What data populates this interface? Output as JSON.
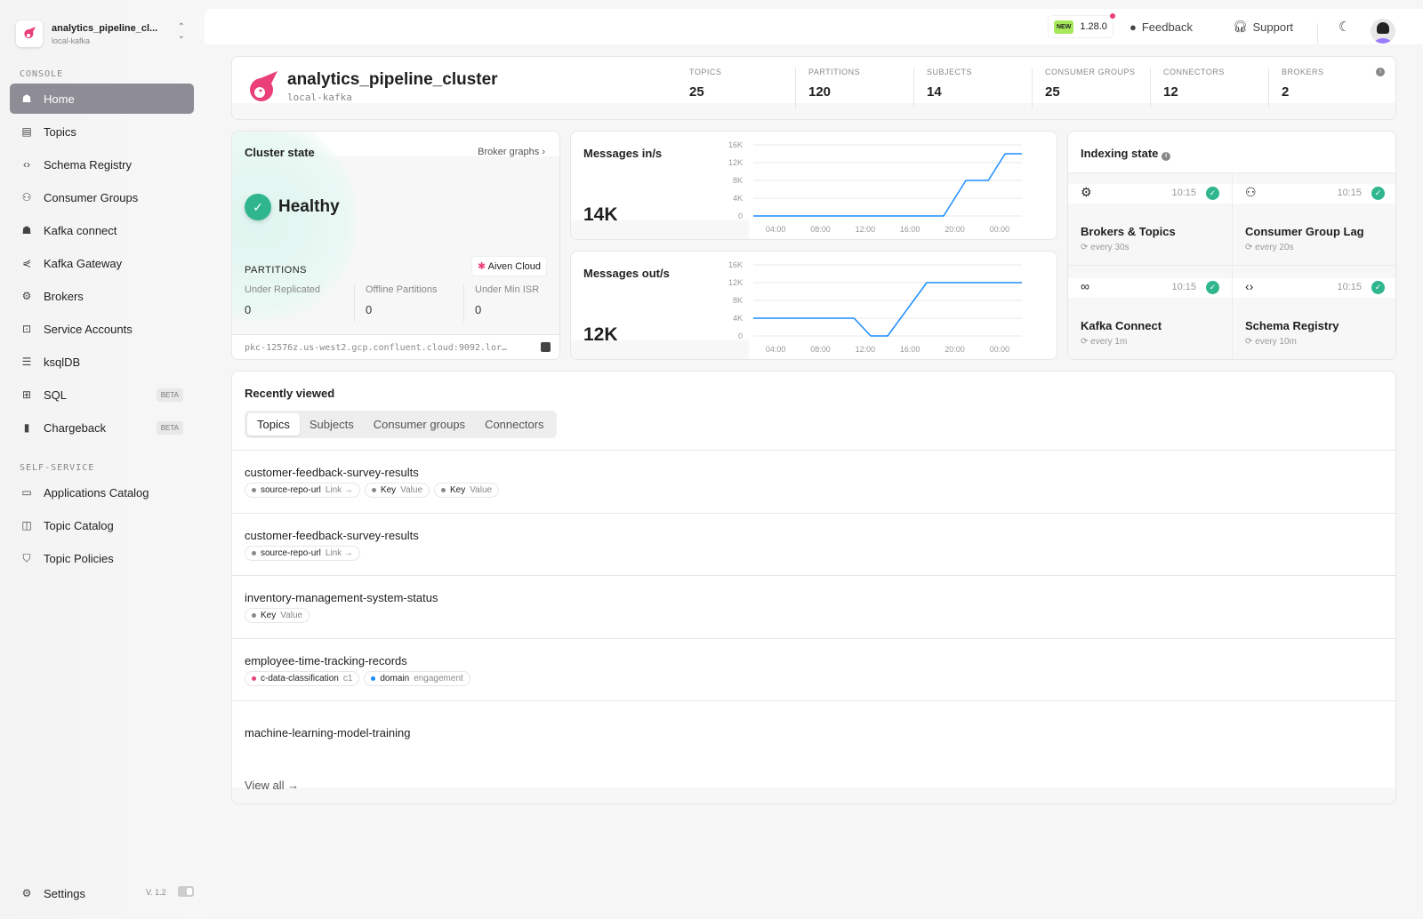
{
  "sidebar": {
    "cluster_name": "analytics_pipeline_cl...",
    "cluster_env": "local-kafka",
    "console_label": "CONSOLE",
    "self_service_label": "SELF-SERVICE",
    "items": [
      {
        "label": "Home",
        "icon": "home-icon"
      },
      {
        "label": "Topics",
        "icon": "topics-icon"
      },
      {
        "label": "Schema Registry",
        "icon": "code-icon"
      },
      {
        "label": "Consumer Groups",
        "icon": "hierarchy-icon"
      },
      {
        "label": "Kafka connect",
        "icon": "connect-icon"
      },
      {
        "label": "Kafka Gateway",
        "icon": "gateway-icon"
      },
      {
        "label": "Brokers",
        "icon": "chip-icon"
      },
      {
        "label": "Service Accounts",
        "icon": "account-lock-icon"
      },
      {
        "label": "ksqlDB",
        "icon": "database-icon"
      },
      {
        "label": "SQL",
        "icon": "table-icon",
        "badge": "BETA"
      },
      {
        "label": "Chargeback",
        "icon": "bar-chart-icon",
        "badge": "BETA"
      }
    ],
    "self_service": [
      {
        "label": "Applications Catalog",
        "icon": "window-icon"
      },
      {
        "label": "Topic Catalog",
        "icon": "catalog-icon"
      },
      {
        "label": "Topic Policies",
        "icon": "shield-icon"
      }
    ],
    "settings_label": "Settings",
    "version": "V. 1.2"
  },
  "topbar": {
    "new_badge": "NEW",
    "version": "1.28.0",
    "feedback": "Feedback",
    "support": "Support"
  },
  "cluster": {
    "name": "analytics_pipeline_cluster",
    "env": "local-kafka",
    "stats": [
      {
        "label": "TOPICS",
        "value": "25"
      },
      {
        "label": "PARTITIONS",
        "value": "120"
      },
      {
        "label": "SUBJECTS",
        "value": "14"
      },
      {
        "label": "CONSUMER GROUPS",
        "value": "25"
      },
      {
        "label": "CONNECTORS",
        "value": "12"
      },
      {
        "label": "BROKERS",
        "value": "2"
      }
    ]
  },
  "cluster_state": {
    "title": "Cluster state",
    "broker_graphs": "Broker graphs",
    "status": "Healthy",
    "partitions_label": "PARTITIONS",
    "provider": "Aiven Cloud",
    "metrics": [
      {
        "label": "Under Replicated",
        "value": "0"
      },
      {
        "label": "Offline Partitions",
        "value": "0"
      },
      {
        "label": "Under Min ISR",
        "value": "0"
      }
    ],
    "bootstrap": "pkc-12576z.us-west2.gcp.confluent.cloud:9092.lor…"
  },
  "chart_data": [
    {
      "type": "line",
      "title": "Messages in/s",
      "current": "14K",
      "yticks": [
        "0",
        "4K",
        "8K",
        "12K",
        "16K"
      ],
      "ylim": [
        0,
        16000
      ],
      "xticks": [
        "04:00",
        "08:00",
        "12:00",
        "16:00",
        "20:00",
        "00:00"
      ],
      "xlim": [
        "02:00",
        "02:00"
      ],
      "color": "#1a8cff",
      "points": [
        [
          "02:00",
          0
        ],
        [
          "19:00",
          0
        ],
        [
          "21:00",
          8000
        ],
        [
          "23:00",
          8000
        ],
        [
          "00:30",
          14000
        ],
        [
          "02:00",
          14000
        ]
      ]
    },
    {
      "type": "line",
      "title": "Messages out/s",
      "current": "12K",
      "yticks": [
        "0",
        "4K",
        "8K",
        "12K",
        "16K"
      ],
      "ylim": [
        0,
        16000
      ],
      "xticks": [
        "04:00",
        "08:00",
        "12:00",
        "16:00",
        "20:00",
        "00:00"
      ],
      "xlim": [
        "02:00",
        "02:00"
      ],
      "color": "#1a8cff",
      "points": [
        [
          "02:00",
          4000
        ],
        [
          "11:00",
          4000
        ],
        [
          "12:30",
          0
        ],
        [
          "14:00",
          0
        ],
        [
          "17:30",
          12000
        ],
        [
          "02:00",
          12000
        ]
      ]
    }
  ],
  "indexing": {
    "title": "Indexing state",
    "items": [
      {
        "name": "Brokers & Topics",
        "time": "10:15",
        "every": "every 30s",
        "icon": "chip-icon"
      },
      {
        "name": "Consumer Group Lag",
        "time": "10:15",
        "every": "every 20s",
        "icon": "hierarchy-icon"
      },
      {
        "name": "Kafka Connect",
        "time": "10:15",
        "every": "every 1m",
        "icon": "link-icon"
      },
      {
        "name": "Schema Registry",
        "time": "10:15",
        "every": "every 10m",
        "icon": "code-icon"
      }
    ]
  },
  "recent": {
    "title": "Recently viewed",
    "tabs": [
      "Topics",
      "Subjects",
      "Consumer groups",
      "Connectors"
    ],
    "view_all": "View all →",
    "rows": [
      {
        "name": "customer-feedback-survey-results",
        "chips": [
          {
            "key": "source-repo-url",
            "value": "Link →",
            "color": "#888888"
          },
          {
            "key": "Key",
            "value": "Value",
            "color": "#888888"
          },
          {
            "key": "Key",
            "value": "Value",
            "color": "#888888"
          }
        ]
      },
      {
        "name": "customer-feedback-survey-results",
        "chips": [
          {
            "key": "source-repo-url",
            "value": "Link →",
            "color": "#888888"
          }
        ]
      },
      {
        "name": "inventory-management-system-status",
        "chips": [
          {
            "key": "Key",
            "value": "Value",
            "color": "#888888"
          }
        ]
      },
      {
        "name": "employee-time-tracking-records",
        "chips": [
          {
            "key": "c-data-classification",
            "value": "c1",
            "color": "#e8457a"
          },
          {
            "key": "domain",
            "value": "engagement",
            "color": "#1a8cff"
          }
        ]
      },
      {
        "name": "machine-learning-model-training",
        "chips": []
      }
    ]
  }
}
